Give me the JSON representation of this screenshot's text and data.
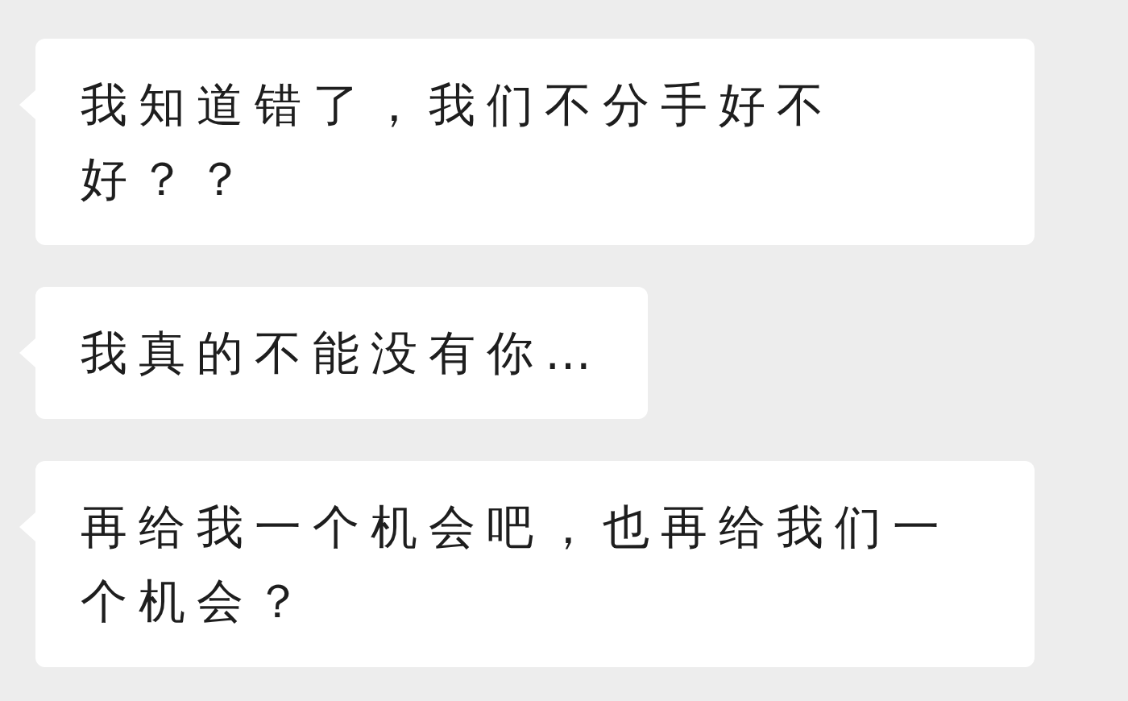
{
  "messages": [
    {
      "text": "我知道错了，我们不分手好不好？？"
    },
    {
      "text": "我真的不能没有你…"
    },
    {
      "text": "再给我一个机会吧，也再给我们一个机会？"
    }
  ]
}
